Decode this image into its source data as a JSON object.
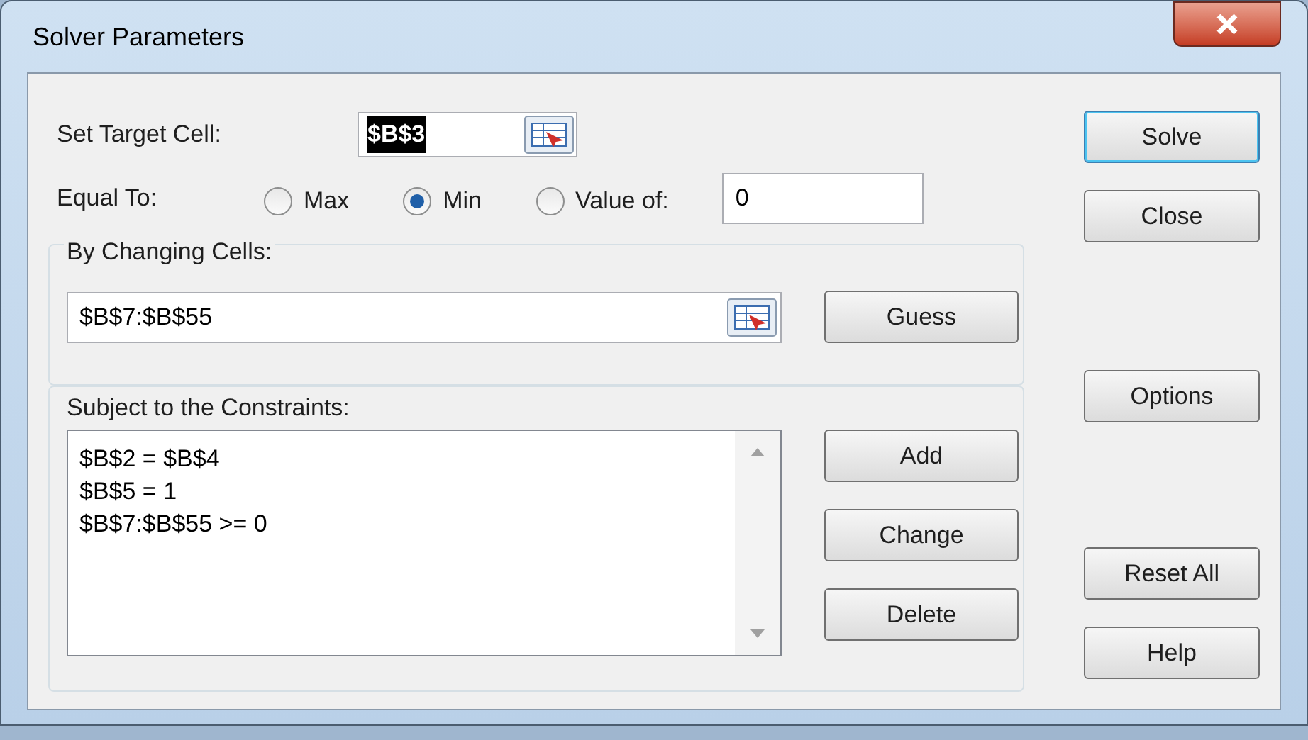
{
  "window": {
    "title": "Solver Parameters"
  },
  "target_cell": {
    "label": "Set Target Cell:",
    "value": "$B$3",
    "selected": true
  },
  "equal_to": {
    "label": "Equal To:",
    "options": [
      {
        "label": "Max",
        "selected": false
      },
      {
        "label": "Min",
        "selected": true
      },
      {
        "label": "Value of:",
        "selected": false
      }
    ],
    "value": "0"
  },
  "changing_cells": {
    "label": "By Changing Cells:",
    "value": "$B$7:$B$55",
    "button": {
      "label": "Guess"
    }
  },
  "constraints": {
    "label": "Subject to the Constraints:",
    "items": [
      "$B$2 = $B$4",
      "$B$5 = 1",
      "$B$7:$B$55 >= 0"
    ],
    "buttons": [
      {
        "label": "Add"
      },
      {
        "label": "Change"
      },
      {
        "label": "Delete"
      }
    ]
  },
  "side_buttons": [
    {
      "label": "Solve",
      "default": true
    },
    {
      "label": "Close",
      "default": false
    },
    {
      "label": "Options",
      "default": false
    },
    {
      "label": "Reset All",
      "default": false
    },
    {
      "label": "Help",
      "default": false
    }
  ]
}
